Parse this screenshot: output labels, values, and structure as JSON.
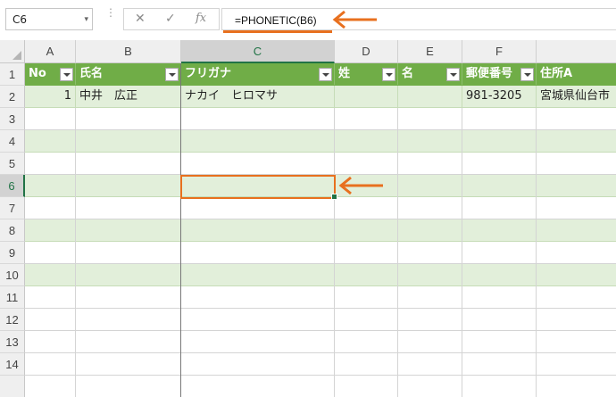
{
  "formula_bar": {
    "name_box": "C6",
    "name_caret": "▾",
    "cancel": "✕",
    "enter": "✓",
    "fx": "fx",
    "formula": "=PHONETIC(B6)"
  },
  "columns": [
    "A",
    "B",
    "C",
    "D",
    "E",
    "F",
    "G"
  ],
  "rows": [
    "1",
    "2",
    "3",
    "4",
    "5",
    "6",
    "7",
    "8",
    "9",
    "10",
    "11",
    "12",
    "13",
    "14"
  ],
  "table": {
    "headers": [
      "No",
      "氏名",
      "フリガナ",
      "姓",
      "名",
      "郵便番号",
      "住所A"
    ],
    "row2": [
      "1",
      "中井　広正",
      "ナカイ　ヒロマサ",
      "",
      "",
      "981-3205",
      "宮城県仙台市"
    ]
  },
  "selected_cell": "C6",
  "colors": {
    "header_fill": "#70ad47",
    "band_fill": "#e2efda",
    "highlight": "#e8701f",
    "excel_green": "#217346"
  },
  "icons": [
    "dropdown-arrow-icon",
    "cancel-icon",
    "enter-icon",
    "function-icon",
    "filter-button-icon",
    "arrow-left-icon"
  ]
}
